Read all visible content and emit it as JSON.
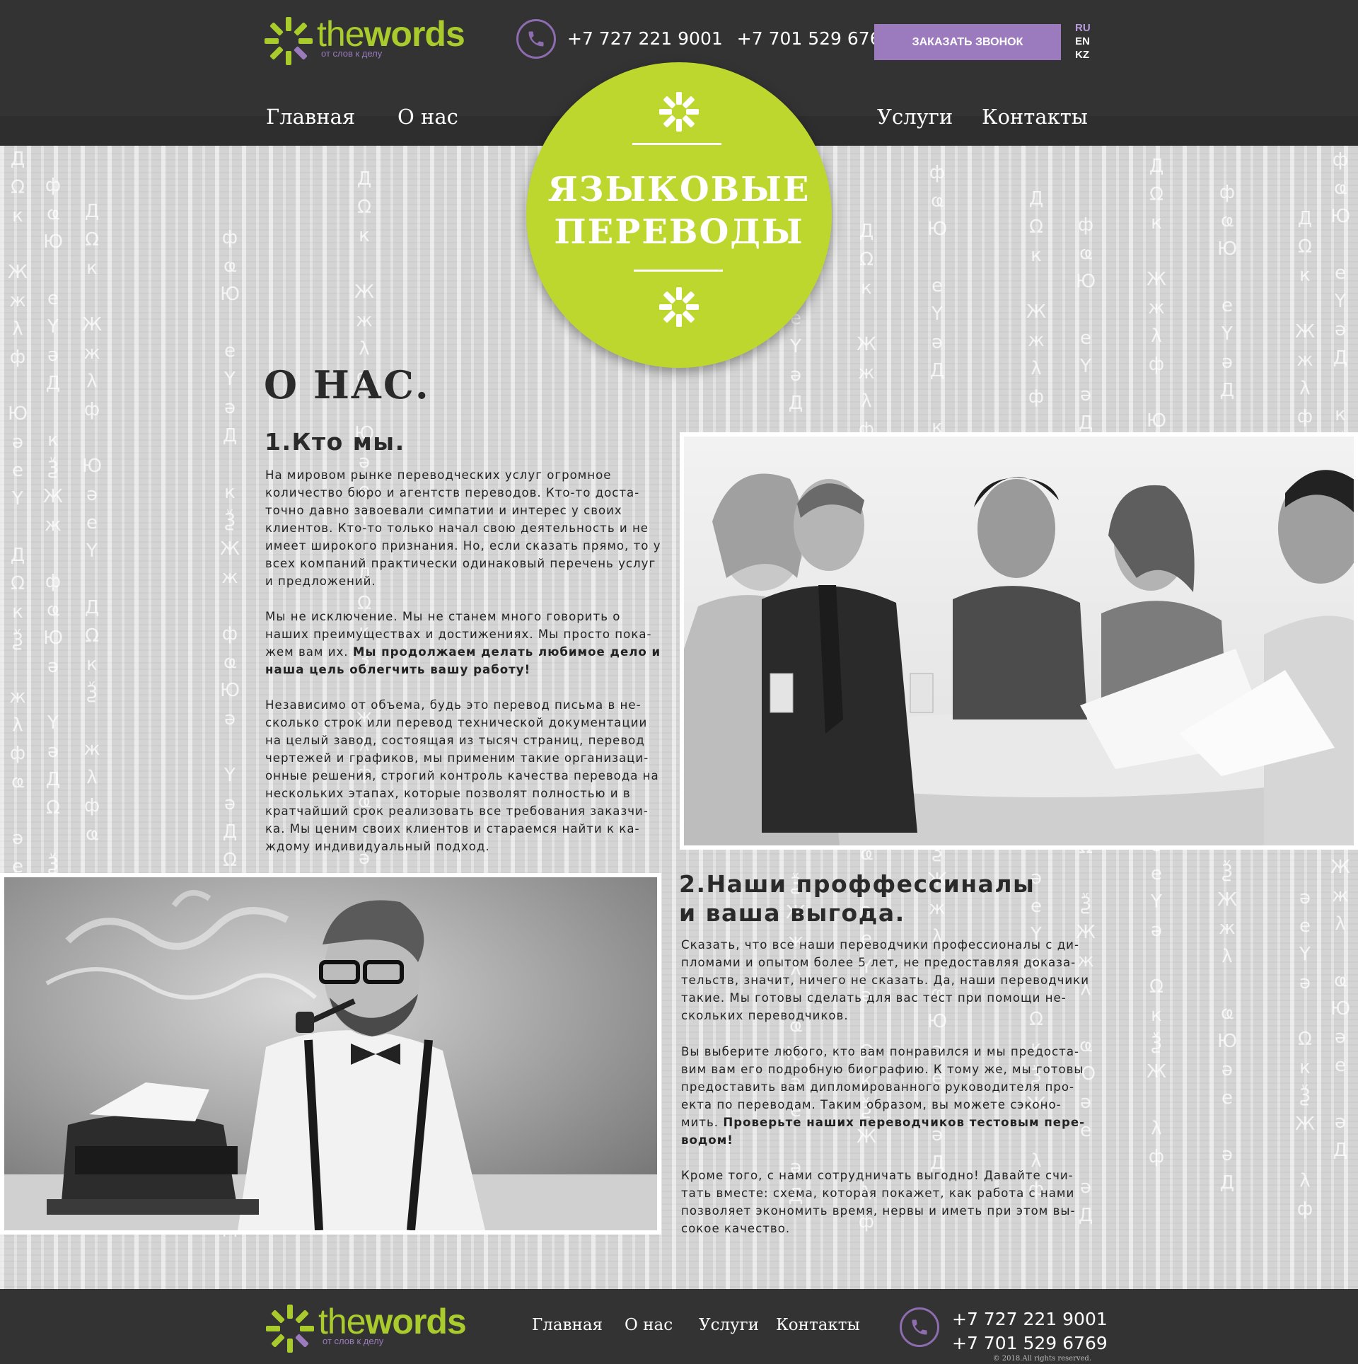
{
  "header": {
    "logo": {
      "name_light": "the",
      "name_bold": "words",
      "tagline": "от слов к делу"
    },
    "phones": [
      "+7 727 221 9001",
      "+7 701 529 6769"
    ],
    "callback_label": "ЗАКАЗАТЬ ЗВОНОК",
    "languages": [
      "RU",
      "EN",
      "KZ"
    ],
    "active_language": "RU",
    "nav": [
      "Главная",
      "О нас",
      "Услуги",
      "Контакты"
    ]
  },
  "badge": {
    "title_line1": "ЯЗЫКОВЫЕ",
    "title_line2": "ПЕРЕВОДЫ"
  },
  "about": {
    "heading": "О НАС.",
    "section1": {
      "title": "1.Кто мы.",
      "p1": "На мировом рынке переводческих услуг огромное количество бюро и агентств переводов. Кто-то доста-точно давно завоевали симпатии и интерес у своих клиентов. Кто-то только начал свою деятельность и не имеет широкого признания. Но, если сказать прямо, то у всех компаний практически одинаковый перечень услуг и предложений.",
      "p2": "Мы не исключение. Мы не станем много говорить о наших преимуществах и достижениях. Мы просто пока-жем вам их.",
      "p2_bold": "Мы продолжаем делать любимое дело и наша цель облегчить вашу работу!",
      "p3": "Независимо от объема, будь это перевод письма в не-сколько строк или перевод технической документации на целый завод, состоящая из тысяч страниц, перевод чертежей и графиков, мы применим такие организаци-онные решения, строгий контроль качества перевода на нескольких этапах, которые позволят полностью и в кратчайший срок реализовать все требования заказчи-ка. Мы ценим своих клиентов и стараемся найти к ка-ждому индивидуальный подход."
    },
    "section2": {
      "title_line1": "2.Наши проффессиналы",
      "title_line2": "и ваша выгода.",
      "p1": "Сказать, что все наши переводчики профессионалы с ди-пломами и опытом более 5 лет, не предоставляя доказа-тельств, значит, ничего не сказать. Да, наши переводчики такие. Мы готовы сделать для вас тест при помощи не-скольких переводчиков.",
      "p2": "Вы выберите любого, кто вам понравился и мы предоста-вим вам его подробную биографию. К тому же, мы готовы предоставить вам дипломированного руководителя про-екта по переводам. Таким образом, вы можете сэконо-мить.",
      "p2_bold": "Проверьте наших переводчиков тестовым пере-водом!",
      "p3": "Кроме того, с нами сотрудничать выгодно! Давайте счи-тать вместе: схема, которая покажет, как работа с нами позволяет экономить время, нервы и иметь при этом вы-сокое качество."
    }
  },
  "footer": {
    "nav": [
      "Главная",
      "О нас",
      "Услуги",
      "Контакты"
    ],
    "phones": [
      "+7 727 221 9001",
      "+7 701 529 6769"
    ],
    "copyright": "© 2018.All rights reserved."
  },
  "colors": {
    "brand_green": "#bdd72e",
    "brand_purple": "#9b7bbd",
    "dark": "#333333"
  },
  "icons": [
    "logo-icon",
    "phone-icon",
    "asterisk-icon"
  ]
}
